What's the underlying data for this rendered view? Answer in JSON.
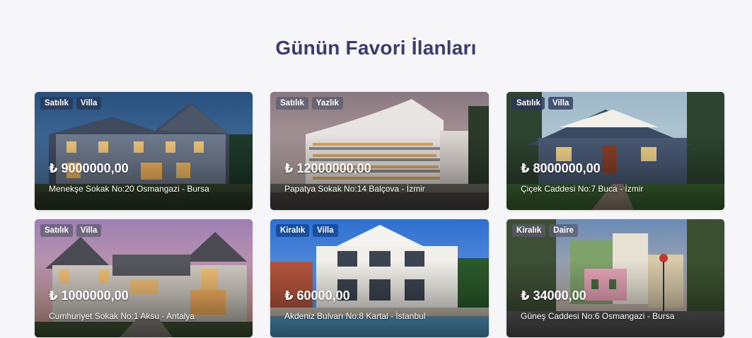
{
  "section": {
    "title": "Günün Favori İlanları"
  },
  "listings": [
    {
      "badges": [
        "Satılık",
        "Villa"
      ],
      "price": "₺ 9000000,00",
      "address": "Menekşe Sokak No:20 Osmangazi - Bursa"
    },
    {
      "badges": [
        "Satılık",
        "Yazlık"
      ],
      "price": "₺ 12000000,00",
      "address": "Papatya Sokak No:14 Balçova - İzmir"
    },
    {
      "badges": [
        "Satılık",
        "Villa"
      ],
      "price": "₺ 8000000,00",
      "address": "Çiçek Caddesi No:7 Buca - İzmir"
    },
    {
      "badges": [
        "Satılık",
        "Villa"
      ],
      "price": "₺ 1000000,00",
      "address": "Cumhuriyet Sokak No:1 Aksu - Antalya"
    },
    {
      "badges": [
        "Kiralık",
        "Villa"
      ],
      "price": "₺ 60000,00",
      "address": "Akdeniz Bulvarı No:8 Kartal - İstanbul"
    },
    {
      "badges": [
        "Kiralık",
        "Daire"
      ],
      "price": "₺ 34000,00",
      "address": "Güneş Caddesi No:6 Osmangazi - Bursa"
    }
  ],
  "colors": {
    "background": "#f6f6f8",
    "title": "#3b3c6b",
    "badge": "#5a5a6e",
    "badge_blue": "#1446a0"
  }
}
